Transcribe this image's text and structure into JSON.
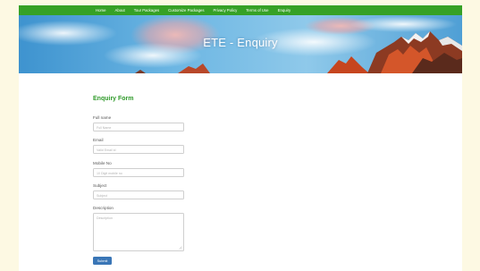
{
  "nav": {
    "items": [
      {
        "label": "Home"
      },
      {
        "label": "About"
      },
      {
        "label": "Tour Packages"
      },
      {
        "label": "Customize Packages"
      },
      {
        "label": "Privacy Policy"
      },
      {
        "label": "Terms of Use"
      },
      {
        "label": "Enquiry"
      }
    ]
  },
  "hero": {
    "title": "ETE - Enquiry"
  },
  "form": {
    "title": "Enquiry Form",
    "fields": [
      {
        "label": "Full name",
        "placeholder": "Full Name"
      },
      {
        "label": "Email",
        "placeholder": "Valid Email id"
      },
      {
        "label": "Mobile No",
        "placeholder": "10 Digit mobile no"
      },
      {
        "label": "Subject",
        "placeholder": "Subject"
      }
    ],
    "description": {
      "label": "Description",
      "placeholder": "Description"
    },
    "submit_label": "Submit"
  },
  "colors": {
    "nav_green": "#36a126",
    "title_green": "#2f9a2a",
    "button_blue": "#3a76b6",
    "page_bg": "#fdf9e3"
  }
}
